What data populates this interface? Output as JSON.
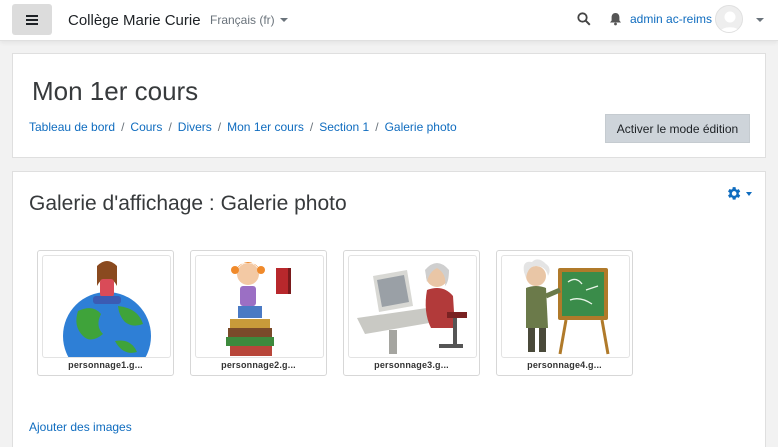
{
  "navbar": {
    "site_name": "Collège Marie Curie",
    "language": "Français (fr)",
    "user_name": "admin ac-reims"
  },
  "header": {
    "course_title": "Mon 1er cours",
    "breadcrumb": [
      "Tableau de bord",
      "Cours",
      "Divers",
      "Mon 1er cours",
      "Section 1",
      "Galerie photo"
    ],
    "edit_button": "Activer le mode édition"
  },
  "gallery": {
    "title": "Galerie d'affichage : Galerie photo",
    "images": [
      {
        "caption": "personnage1.g...",
        "icon": "globe-character-image"
      },
      {
        "caption": "personnage2.g...",
        "icon": "reading-books-character-image"
      },
      {
        "caption": "personnage3.g...",
        "icon": "computer-user-character-image"
      },
      {
        "caption": "personnage4.g...",
        "icon": "einstein-blackboard-character-image"
      }
    ],
    "add_images": "Ajouter des images"
  },
  "colors": {
    "link": "#0f6cbf",
    "button": "#ced4da"
  }
}
